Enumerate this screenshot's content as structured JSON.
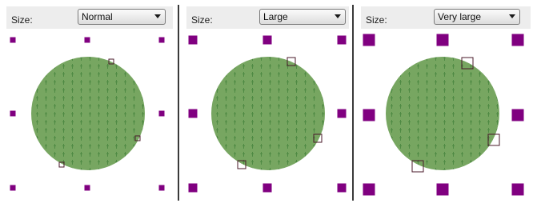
{
  "panels": [
    {
      "id": "normal",
      "size_label": "Size:",
      "selected_size": "Normal",
      "handle_size": "normal"
    },
    {
      "id": "large",
      "size_label": "Size:",
      "selected_size": "Large",
      "handle_size": "large"
    },
    {
      "id": "very-large",
      "size_label": "Size:",
      "selected_size": "Very large",
      "handle_size": "very large"
    }
  ],
  "colors": {
    "circle_fill": "#77a661",
    "circle_pattern": "#4f8a44",
    "handle_fill": "#800080",
    "rotation_handle_stroke": "#4a1a2a",
    "toolbar_bg": "#ededed",
    "divider": "#3a3a3a"
  },
  "icons": {
    "dropdown": "chevron-down-icon",
    "resize_handle": "square-handle-icon",
    "rotation_handle": "square-outline-handle-icon"
  }
}
